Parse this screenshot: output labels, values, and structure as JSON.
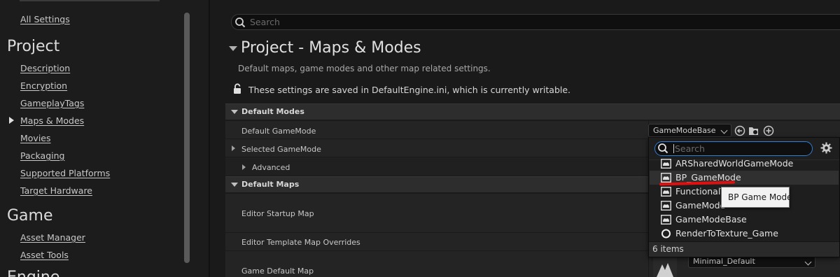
{
  "sidebar": {
    "all_settings": "All Settings",
    "sections": [
      {
        "title": "Project"
      },
      {
        "title": "Game"
      },
      {
        "title": "Engine"
      }
    ],
    "project_items": [
      "Description",
      "Encryption",
      "GameplayTags",
      "Maps & Modes",
      "Movies",
      "Packaging",
      "Supported Platforms",
      "Target Hardware"
    ],
    "active_item": "Maps & Modes",
    "game_items": [
      "Asset Manager",
      "Asset Tools"
    ]
  },
  "search": {
    "placeholder": "Search"
  },
  "page": {
    "title": "Project - Maps & Modes",
    "description": "Default maps, game modes and other map related settings.",
    "lock_text": "These settings are saved in DefaultEngine.ini, which is currently writable."
  },
  "categories": {
    "default_modes": "Default Modes",
    "default_maps": "Default Maps"
  },
  "properties": {
    "default_gamemode": "Default GameMode",
    "selected_gamemode": "Selected GameMode",
    "advanced": "Advanced",
    "editor_startup_map": "Editor Startup Map",
    "editor_template_overrides": "Editor Template Map Overrides",
    "game_default_map": "Game Default Map"
  },
  "gamemode_combo": {
    "value": "GameModeBase"
  },
  "game_default_map_combo": {
    "value": "Minimal_Default"
  },
  "popup": {
    "search_placeholder": "Search",
    "items": [
      {
        "label": "ARSharedWorldGameMode",
        "icon": "blueprint-icon"
      },
      {
        "label": "BP_GameMode",
        "icon": "blueprint-icon"
      },
      {
        "label": "FunctionalT",
        "icon": "blueprint-icon"
      },
      {
        "label": "GameMode",
        "icon": "blueprint-icon"
      },
      {
        "label": "GameModeBase",
        "icon": "blueprint-icon"
      },
      {
        "label": "RenderToTexture_Game",
        "icon": "circle-icon"
      }
    ],
    "hovered_item": "BP_GameMode",
    "count": "6 items"
  },
  "tooltip": {
    "text": "BP Game Mode"
  },
  "colors": {
    "accent_blue": "#2f7fd6",
    "annotation_red": "#e01010",
    "background": "#1a1a1a"
  }
}
